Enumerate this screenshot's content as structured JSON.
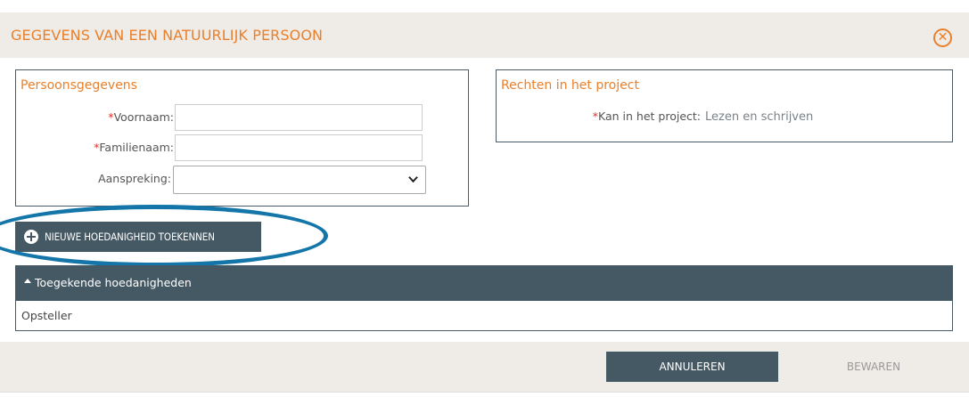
{
  "dialog": {
    "title": "GEGEVENS VAN EEN NATUURLIJK PERSOON",
    "close_icon": "circle-x-icon"
  },
  "person_panel": {
    "title": "Persoonsgegevens",
    "fields": {
      "first_name": {
        "required_mark": "*",
        "label": "Voornaam:",
        "value": ""
      },
      "last_name": {
        "required_mark": "*",
        "label": "Familienaam:",
        "value": ""
      },
      "salutation": {
        "label": "Aanspreking:",
        "selected": ""
      }
    }
  },
  "rights_panel": {
    "title": "Rechten in het project",
    "required_mark": "*",
    "label": "Kan in het project:",
    "value": "Lezen en schrijven"
  },
  "assign_button": {
    "label": "NIEUWE HOEDANIGHEID TOEKENNEN",
    "icon": "plus-circle-icon"
  },
  "highlight": {
    "color": "#1476a8"
  },
  "assigned_roles": {
    "header": "Toegekende hoedanigheden",
    "items": [
      "Opsteller"
    ]
  },
  "footer": {
    "cancel_label": "ANNULEREN",
    "save_label": "BEWAREN"
  },
  "colors": {
    "accent": "#e8802d",
    "dark": "#455964",
    "background": "#efebe6",
    "required": "#d9322a"
  }
}
